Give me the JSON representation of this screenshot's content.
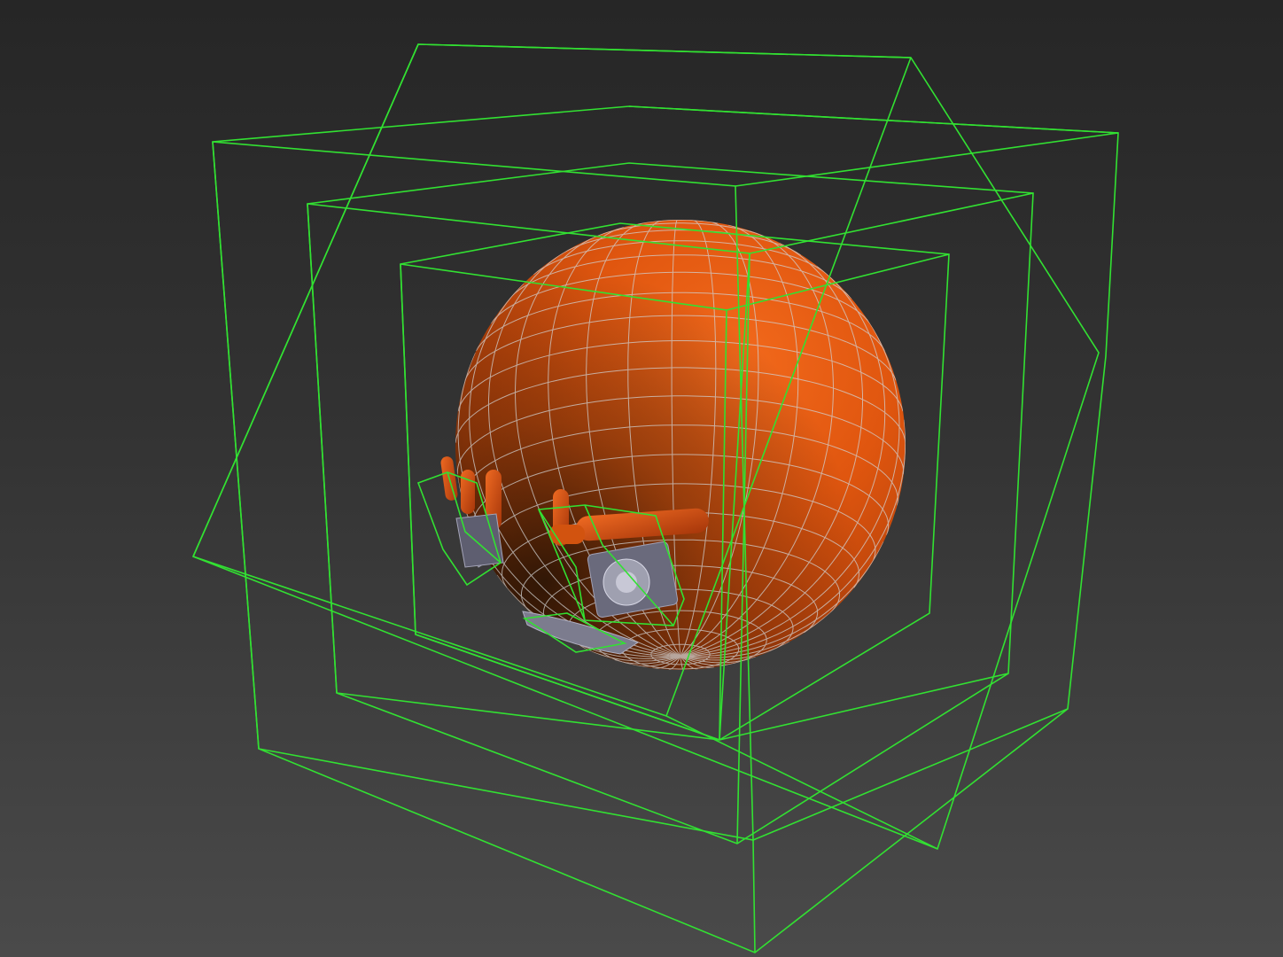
{
  "viewport": {
    "background_top": "#262626",
    "background_bottom": "#4a4a4a"
  },
  "colors": {
    "wire_green": "#32e132",
    "sphere_highlight": "#f36a1c",
    "sphere_mid": "#e0560f",
    "sphere_shadow": "#7a2a06",
    "sphere_grid": "#c9c9c9",
    "mesh_gray": "#8a8a9a"
  },
  "scene": {
    "sphere_object": "orange-sphere-mesh",
    "helper_objects": [
      "bounding-cage-outer",
      "bounding-cage-rotated",
      "bounding-cage-middle",
      "bounding-cage-inner"
    ],
    "attached_parts": [
      "hand-part-left",
      "hand-part-right",
      "sensor-pod-left",
      "sensor-pod-center",
      "foot-part-bottom"
    ]
  }
}
